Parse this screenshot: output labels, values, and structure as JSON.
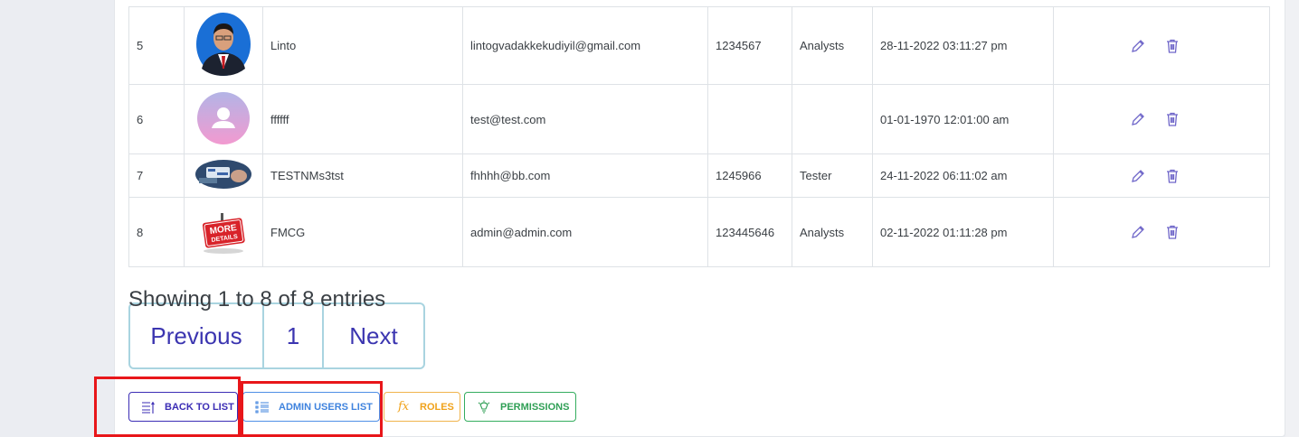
{
  "users": [
    {
      "num": "5",
      "avatar": "photo-man-icon",
      "name": "Linto",
      "email": "lintogvadakkekudiyil@gmail.com",
      "phone": "1234567",
      "role": "Analysts",
      "date": "28-11-2022 03:11:27 pm"
    },
    {
      "num": "6",
      "avatar": "default-avatar-icon",
      "name": "ffffff",
      "email": "test@test.com",
      "phone": "",
      "role": "",
      "date": "01-01-1970 12:01:00 am"
    },
    {
      "num": "7",
      "avatar": "thumbnail-image-icon",
      "name": "TESTNMs3tst",
      "email": "fhhhh@bb.com",
      "phone": "1245966",
      "role": "Tester",
      "date": "24-11-2022 06:11:02 am"
    },
    {
      "num": "8",
      "avatar": "more-details-sign-icon",
      "name": "FMCG",
      "email": "admin@admin.com",
      "phone": "123445646",
      "role": "Analysts",
      "date": "02-11-2022 01:11:28 pm"
    }
  ],
  "actions": {
    "edit_icon": "pencil-icon",
    "delete_icon": "trash-icon"
  },
  "avatar_labels": {
    "more_line1": "MORE",
    "more_line2": "DETAILS"
  },
  "pagination": {
    "info": "Showing 1 to 8 of 8 entries",
    "previous": "Previous",
    "page": "1",
    "next": "Next"
  },
  "buttons": {
    "back_to_list": "BACK TO LIST",
    "admin_users_list": "ADMIN USERS LIST",
    "roles": "ROLES",
    "permissions": "PERMISSIONS"
  },
  "colors": {
    "accent": "#3b2db5",
    "admin": "#3f83de",
    "roles": "#f0a21a",
    "permissions": "#2f9f55",
    "highlight": "#e8161a",
    "action_icon": "#6f66c9"
  }
}
